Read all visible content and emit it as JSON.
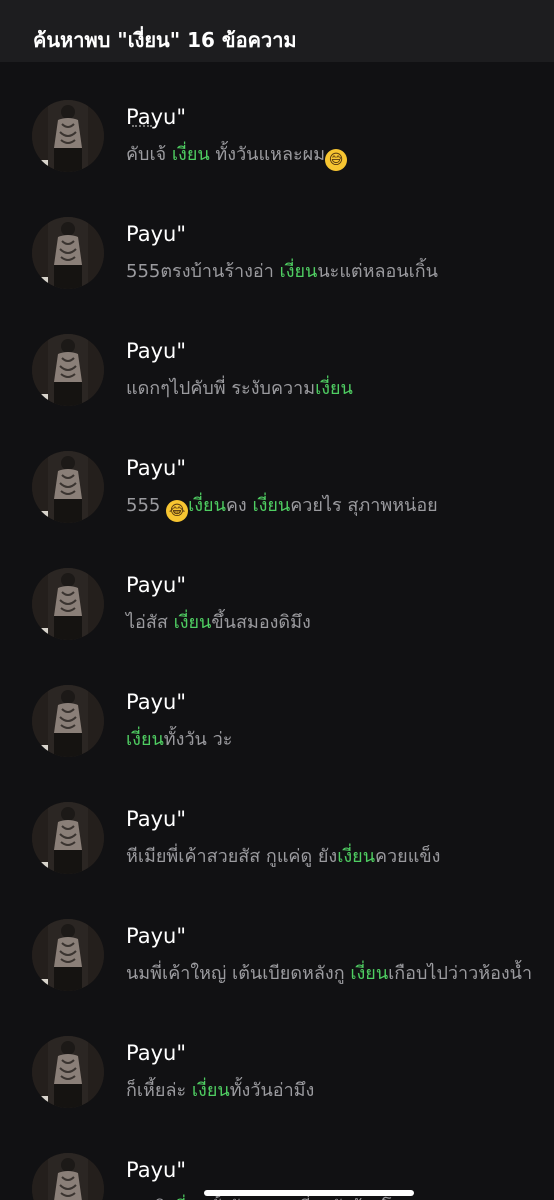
{
  "header": {
    "title": "ค้นหาพบ \"เงี่ยน\" 16 ข้อความ"
  },
  "results": [
    {
      "name": "Payu\"",
      "parts": [
        {
          "t": "คับเจ้ "
        },
        {
          "t": "เงี่ยน",
          "h": true
        },
        {
          "t": " ทั้งวันแหละผม"
        },
        {
          "e": "sweat-smile-emoji"
        }
      ]
    },
    {
      "name": "Payu\"",
      "parts": [
        {
          "t": "555ตรงบ้านร้างอ่า  "
        },
        {
          "t": "เงี่ยน",
          "h": true
        },
        {
          "t": "นะแต่หลอนเกิ้น"
        }
      ]
    },
    {
      "name": "Payu\"",
      "parts": [
        {
          "t": "แดกๆไปคับพี่ ระงับความ"
        },
        {
          "t": "เงี่ยน",
          "h": true
        }
      ]
    },
    {
      "name": "Payu\"",
      "parts": [
        {
          "t": "555 "
        },
        {
          "e": "tears-of-joy-emoji"
        },
        {
          "t": "เงี่ยน",
          "h": true
        },
        {
          "t": "คง "
        },
        {
          "t": "เงี่ยน",
          "h": true
        },
        {
          "t": "ควยไร สุภาพหน่อย"
        }
      ]
    },
    {
      "name": "Payu\"",
      "parts": [
        {
          "t": "ไอ่สัส "
        },
        {
          "t": "เงี่ยน",
          "h": true
        },
        {
          "t": "ขึ้นสมองดิมึง"
        }
      ]
    },
    {
      "name": "Payu\"",
      "parts": [
        {
          "t": "เงี่ยน",
          "h": true
        },
        {
          "t": "ทั้งวัน ว่ะ"
        }
      ]
    },
    {
      "name": "Payu\"",
      "parts": [
        {
          "t": "หีเมียพี่เค้าสวยสัส กูแค่ดู ยัง"
        },
        {
          "t": "เงี่ยน",
          "h": true
        },
        {
          "t": "ควยแข็ง"
        }
      ]
    },
    {
      "name": "Payu\"",
      "parts": [
        {
          "t": "นมพี่เค้าใหญ่ เต้นเบียดหลังกู "
        },
        {
          "t": "เงี่ยน",
          "h": true
        },
        {
          "t": "เกือบไปว่าวห้องน้ำ"
        }
      ]
    },
    {
      "name": "Payu\"",
      "parts": [
        {
          "t": "ก็เหี้ยล่ะ "
        },
        {
          "t": "เงี่ยน",
          "h": true
        },
        {
          "t": "ทั้งวันอ่ามึง"
        }
      ]
    },
    {
      "name": "Payu\"",
      "parts": [
        {
          "t": "เออดิ "
        },
        {
          "t": "เงี่ยน",
          "h": true
        },
        {
          "t": "ทั้งวัน  ตอนเที่ยวยังต้องโดนดูดควย"
        }
      ]
    }
  ],
  "colors": {
    "highlight": "#4fce62",
    "message": "#9b9b9f",
    "name": "#ffffff",
    "background": "#111113"
  }
}
